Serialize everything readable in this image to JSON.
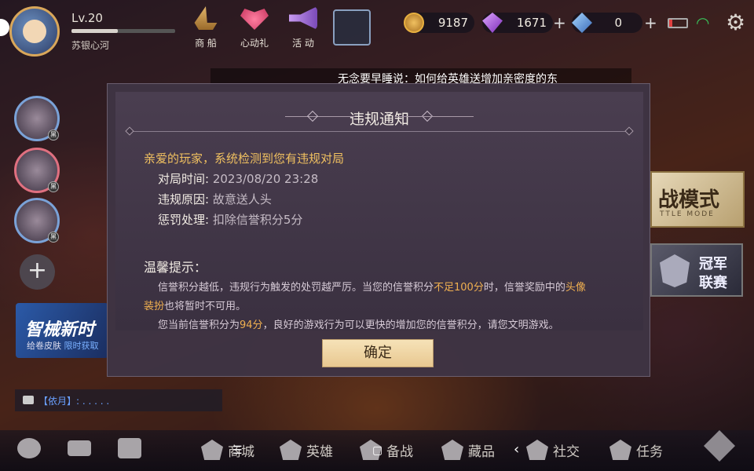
{
  "player": {
    "level": "Lv.20",
    "name": "苏银心河",
    "xp_fraction": 0.45
  },
  "topnav": [
    {
      "label": "商 船",
      "icon": "ship-icon"
    },
    {
      "label": "心动礼",
      "icon": "heart-gift-icon"
    },
    {
      "label": "活 动",
      "icon": "horn-icon"
    }
  ],
  "currency": {
    "gold": "9187",
    "purple_gem": "1671",
    "blue_gem": "0",
    "plus": "+"
  },
  "marquee": "无念要早睡说：如何给英雄送增加亲密度的东",
  "friends": {
    "badge": "黑",
    "add": "+"
  },
  "promo": {
    "title": "智械新时",
    "sub_a": "给卷皮肤",
    "sub_b": "限时获取"
  },
  "chat": {
    "text": "【依月】: . . . . ."
  },
  "mode_card": {
    "title": "战模式",
    "sub": "TTLE MODE"
  },
  "champ_card": {
    "line1": "冠军",
    "line2": "联赛"
  },
  "modal": {
    "title": "违规通知",
    "greeting": "亲爱的玩家，系统检测到您有违规对局",
    "rows": [
      {
        "key": "对局时间:",
        "value": " 2023/08/20 23:28"
      },
      {
        "key": "违规原因:",
        "value": " 故意送人头"
      },
      {
        "key": "惩罚处理:",
        "value": " 扣除信誉积分5分"
      }
    ],
    "tip_title": "温馨提示：",
    "tip1_a": "信誉积分越低，违规行为触发的处罚越严厉。当您的信誉积分",
    "tip1_hl": "不足100分",
    "tip1_b": "时，信誉奖励中的",
    "tip1_hl2": "头像",
    "tip2_hl": "装扮",
    "tip2_b": "也将暂时不可用。",
    "tip3_a": "您当前信誉积分为",
    "tip3_hl": "94分",
    "tip3_b": "，良好的游戏行为可以更快的增加您的信誉积分，请您文明游戏。",
    "confirm": "确定"
  },
  "bottom": [
    "商城",
    "英雄",
    "备战",
    "藏品",
    "社交",
    "任务"
  ],
  "navkeys": {
    "menu": "☰",
    "home": "▢",
    "back": "‹"
  }
}
